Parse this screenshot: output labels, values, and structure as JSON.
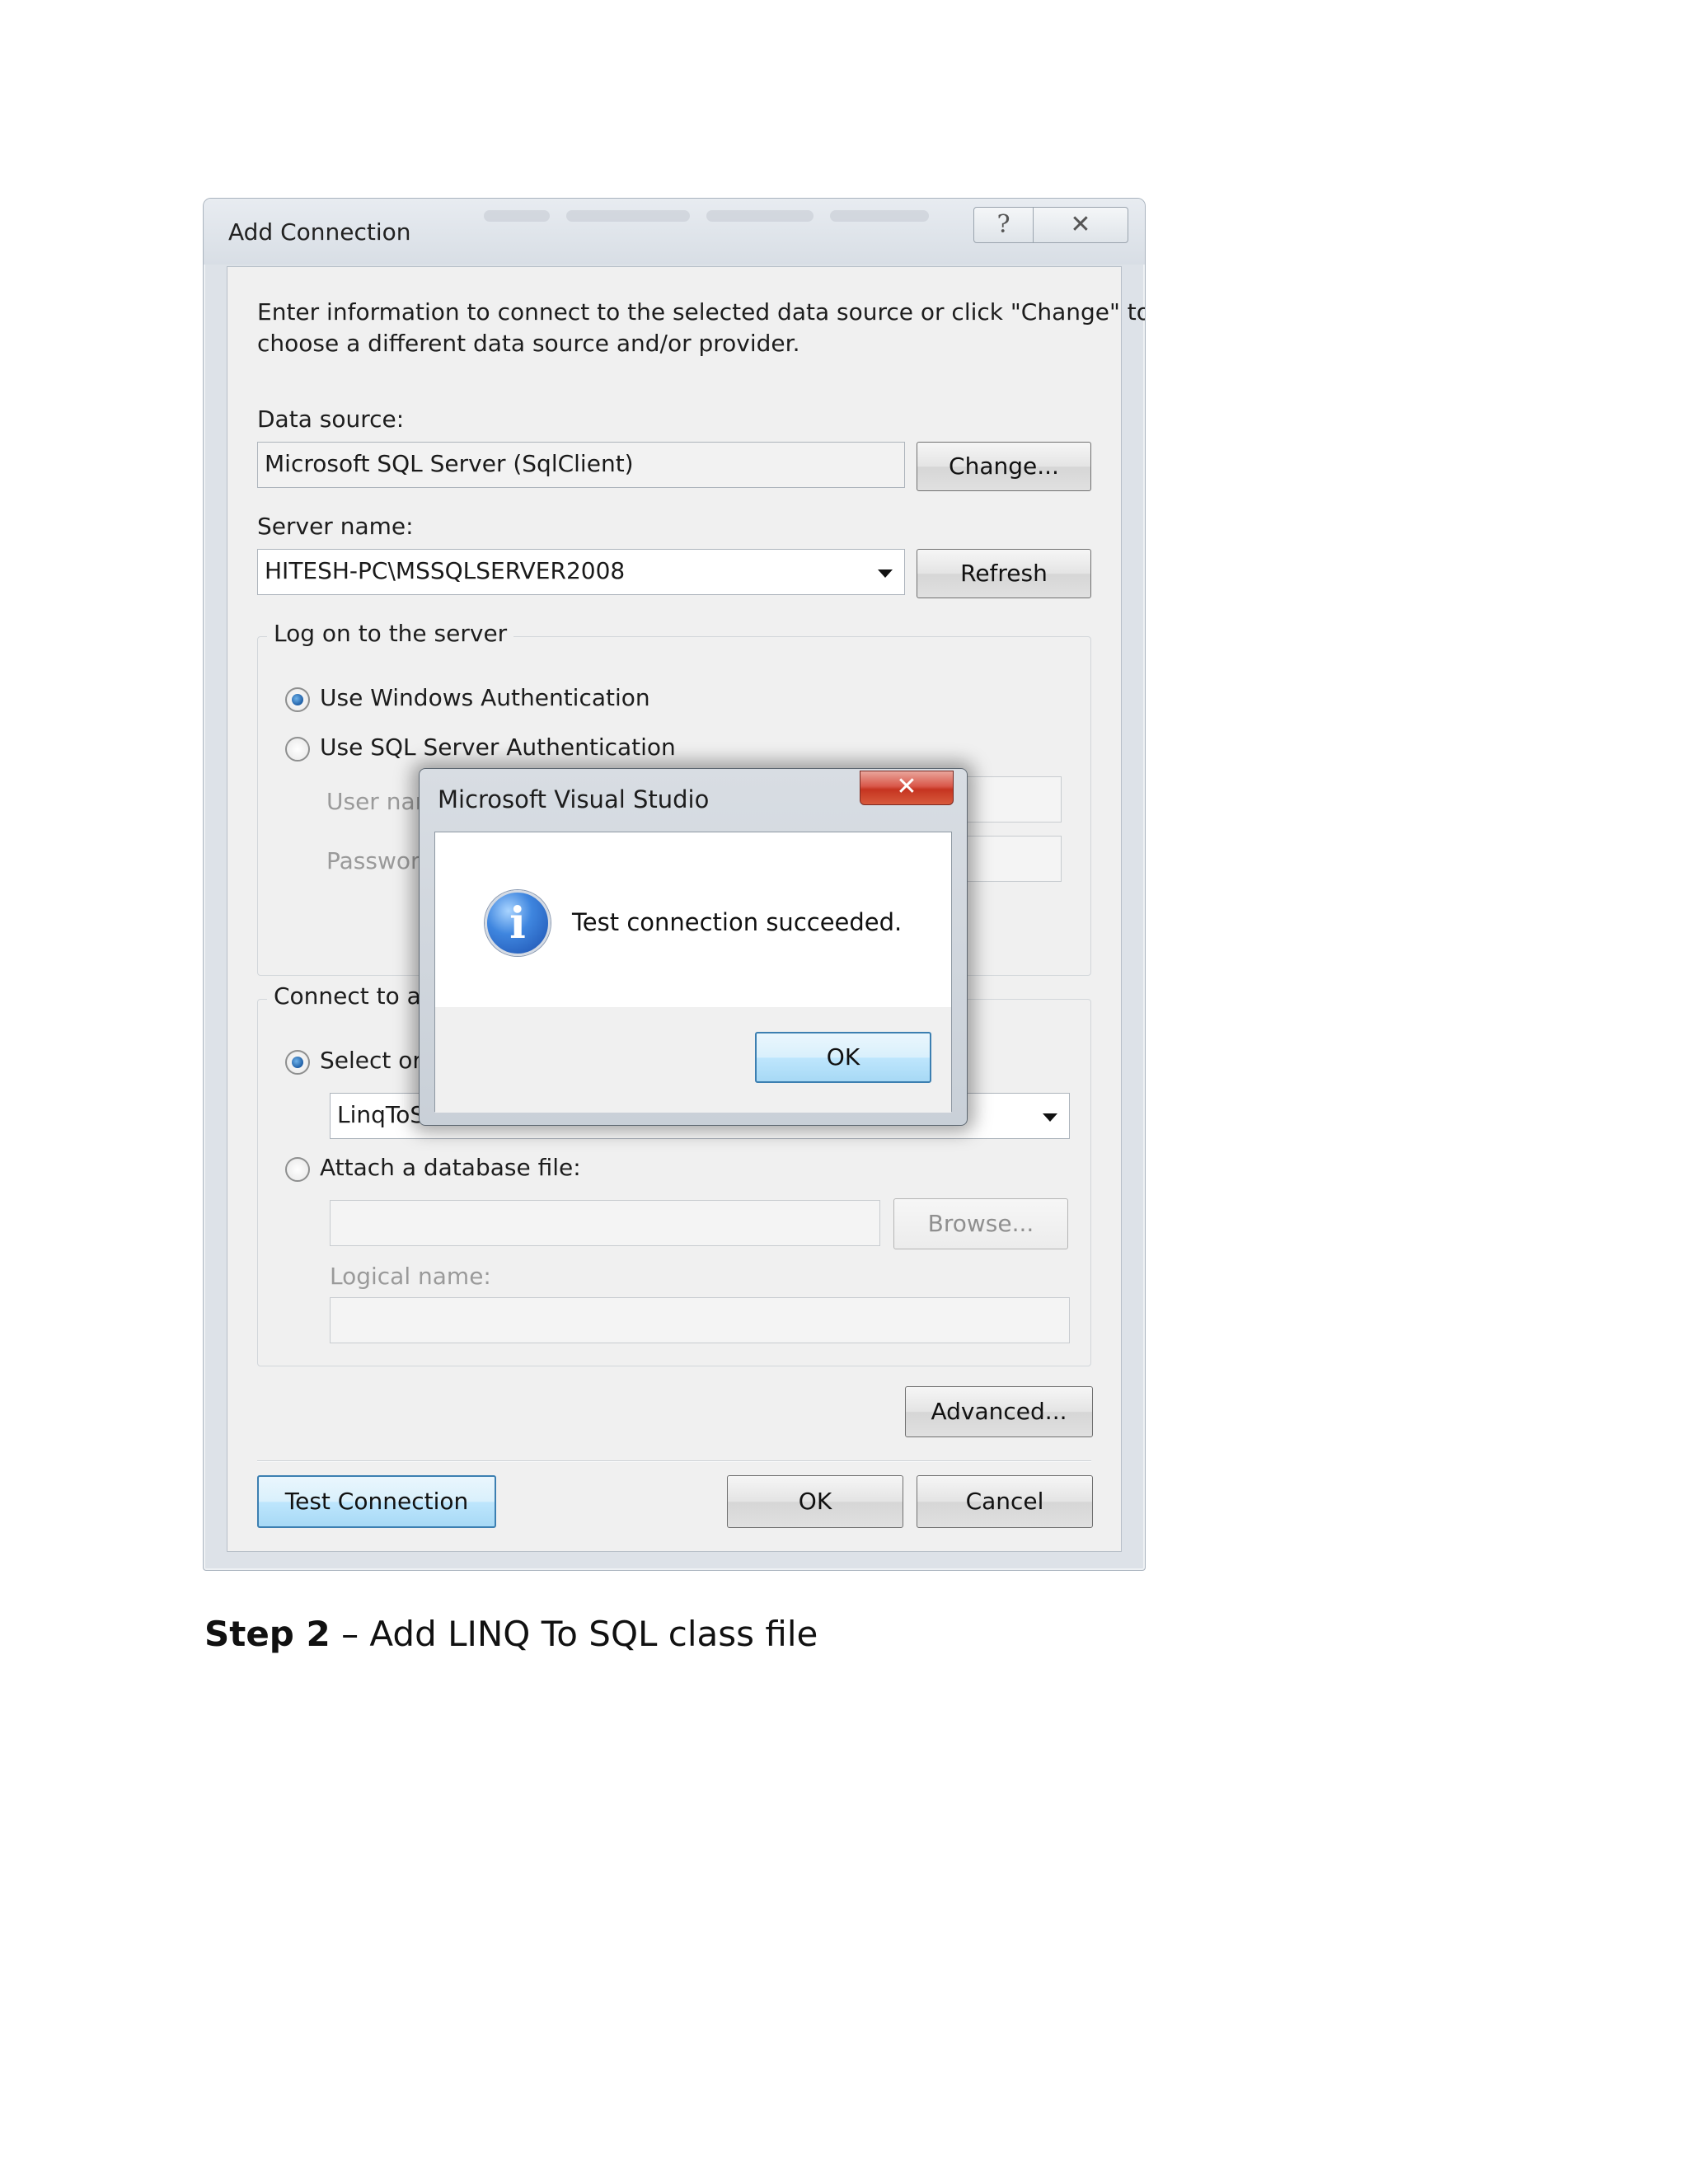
{
  "dialog": {
    "title": "Add Connection",
    "help_glyph": "?",
    "close_glyph": "✕",
    "intro_line1": "Enter information to connect to the selected data source or click \"Change\" to",
    "intro_line2": "choose a different data source and/or provider.",
    "data_source": {
      "label": "Data source:",
      "value": "Microsoft SQL Server (SqlClient)",
      "change_button": "Change..."
    },
    "server_name": {
      "label": "Server name:",
      "value": "HITESH-PC\\MSSQLSERVER2008",
      "refresh_button": "Refresh"
    },
    "logon_group": {
      "caption": "Log on to the server",
      "windows_auth": "Use Windows Authentication",
      "sql_auth": "Use SQL Server Authentication",
      "user_name_label": "User nar",
      "password_label": "Passwor",
      "selected": "windows"
    },
    "database_group": {
      "caption": "Connect to a",
      "select_option": "Select or",
      "database_value": "LinqToS",
      "attach_option": "Attach a database file:",
      "browse_button": "Browse...",
      "logical_name_label": "Logical name:",
      "selected": "select"
    },
    "advanced_button": "Advanced...",
    "test_connection_button": "Test Connection",
    "ok_button": "OK",
    "cancel_button": "Cancel"
  },
  "message_box": {
    "title": "Microsoft Visual Studio",
    "close_glyph": "✕",
    "icon_glyph": "i",
    "message": "Test connection succeeded.",
    "ok_button": "OK"
  },
  "caption": {
    "step": "Step 2",
    "text": " – Add LINQ To SQL class file"
  },
  "colors": {
    "focus_blue": "#3c7fb1",
    "close_red": "#c53420",
    "info_blue": "#1c4fae"
  },
  "icons": [
    "help-icon",
    "close-icon",
    "dropdown-arrow-icon",
    "info-icon"
  ]
}
